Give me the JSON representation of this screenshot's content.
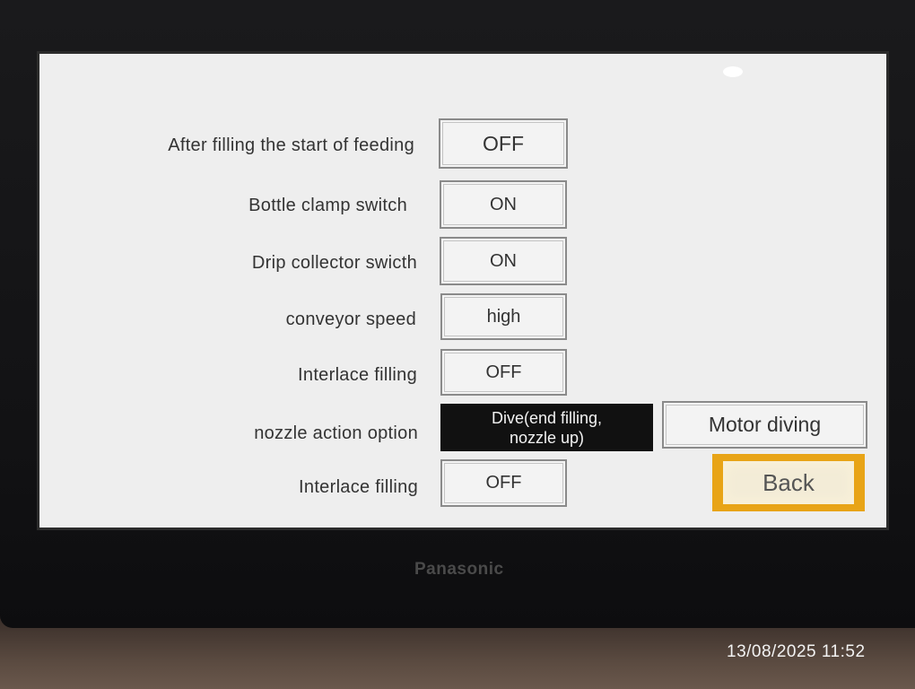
{
  "settings": [
    {
      "label": "After filling the start of feeding",
      "value": "OFF"
    },
    {
      "label": "Bottle clamp switch",
      "value": "ON"
    },
    {
      "label": "Drip collector swicth",
      "value": "ON"
    },
    {
      "label": "conveyor speed",
      "value": "high"
    },
    {
      "label": "Interlace filling",
      "value": "OFF"
    },
    {
      "label": "nozzle action option",
      "value_line1": "Dive(end filling,",
      "value_line2": "nozzle up)",
      "alt_option": "Motor diving"
    },
    {
      "label": "Interlace filling",
      "value": "OFF"
    }
  ],
  "back_label": "Back",
  "brand": "Panasonic",
  "photo_timestamp": "13/08/2025 11:52"
}
